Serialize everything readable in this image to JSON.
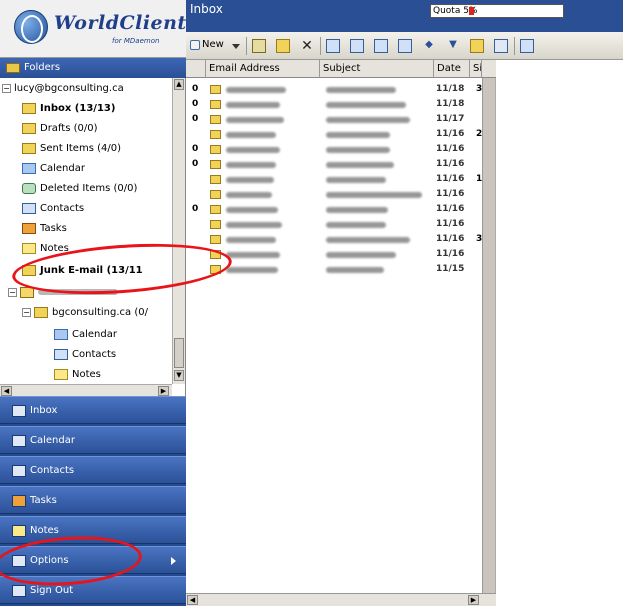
{
  "app": {
    "logo_title": "WorldClient",
    "logo_sub": "for MDaemon"
  },
  "left_panel": {
    "folders_label": "Folders",
    "tree": [
      {
        "label": "lucy@bgconsulting.ca",
        "icon": "expander-minus",
        "bold": false
      },
      {
        "label": "Inbox (13/13)",
        "icon": "folder-icon",
        "bold": true
      },
      {
        "label": "Drafts (0/0)",
        "icon": "folder-icon",
        "bold": false
      },
      {
        "label": "Sent Items (4/0)",
        "icon": "folder-icon",
        "bold": false
      },
      {
        "label": "Calendar",
        "icon": "calendar-icon",
        "bold": false
      },
      {
        "label": "Deleted Items (0/0)",
        "icon": "trash-icon",
        "bold": false
      },
      {
        "label": "Contacts",
        "icon": "contacts-icon",
        "bold": false
      },
      {
        "label": "Tasks",
        "icon": "tasks-icon",
        "bold": false
      },
      {
        "label": "Notes",
        "icon": "notes-icon",
        "bold": false
      },
      {
        "label": "Junk E-mail (13/11",
        "icon": "folder-icon",
        "bold": true
      },
      {
        "label": "bgconsulting.ca (0/",
        "icon": "folder-icon",
        "bold": false
      },
      {
        "label": "Calendar",
        "icon": "calendar-icon",
        "bold": false
      },
      {
        "label": "Contacts",
        "icon": "contacts-icon",
        "bold": false
      },
      {
        "label": "Notes",
        "icon": "notes-icon",
        "bold": false
      }
    ],
    "nav": [
      {
        "label": "Inbox",
        "icon": "inbox-icon"
      },
      {
        "label": "Calendar",
        "icon": "calendar-icon"
      },
      {
        "label": "Contacts",
        "icon": "contacts-icon"
      },
      {
        "label": "Tasks",
        "icon": "tasks-icon"
      },
      {
        "label": "Notes",
        "icon": "notes-icon"
      },
      {
        "label": "Options",
        "icon": "options-icon"
      },
      {
        "label": "Sign Out",
        "icon": "sign-out-icon"
      }
    ]
  },
  "header": {
    "title": "Inbox",
    "quota_label": "Quota 5%",
    "quota_percent": 5
  },
  "toolbar": {
    "new_label": "New"
  },
  "grid": {
    "columns": [
      "Email Address",
      "Subject",
      "Date",
      "Siz"
    ],
    "rows": [
      {
        "attach": true,
        "date": "11/18",
        "size": "3"
      },
      {
        "attach": true,
        "date": "11/18",
        "size": ""
      },
      {
        "attach": true,
        "date": "11/17",
        "size": ""
      },
      {
        "attach": false,
        "date": "11/16",
        "size": "2"
      },
      {
        "attach": true,
        "date": "11/16",
        "size": ""
      },
      {
        "attach": true,
        "date": "11/16",
        "size": ""
      },
      {
        "attach": false,
        "date": "11/16",
        "size": "1"
      },
      {
        "attach": false,
        "date": "11/16",
        "size": ""
      },
      {
        "attach": true,
        "date": "11/16",
        "size": ""
      },
      {
        "attach": false,
        "date": "11/16",
        "size": ""
      },
      {
        "attach": false,
        "date": "11/16",
        "size": "3"
      },
      {
        "attach": false,
        "date": "11/16",
        "size": ""
      },
      {
        "attach": false,
        "date": "11/15",
        "size": ""
      }
    ]
  },
  "colors": {
    "accent": "#2a4f95",
    "highlight": "#e8141a"
  }
}
